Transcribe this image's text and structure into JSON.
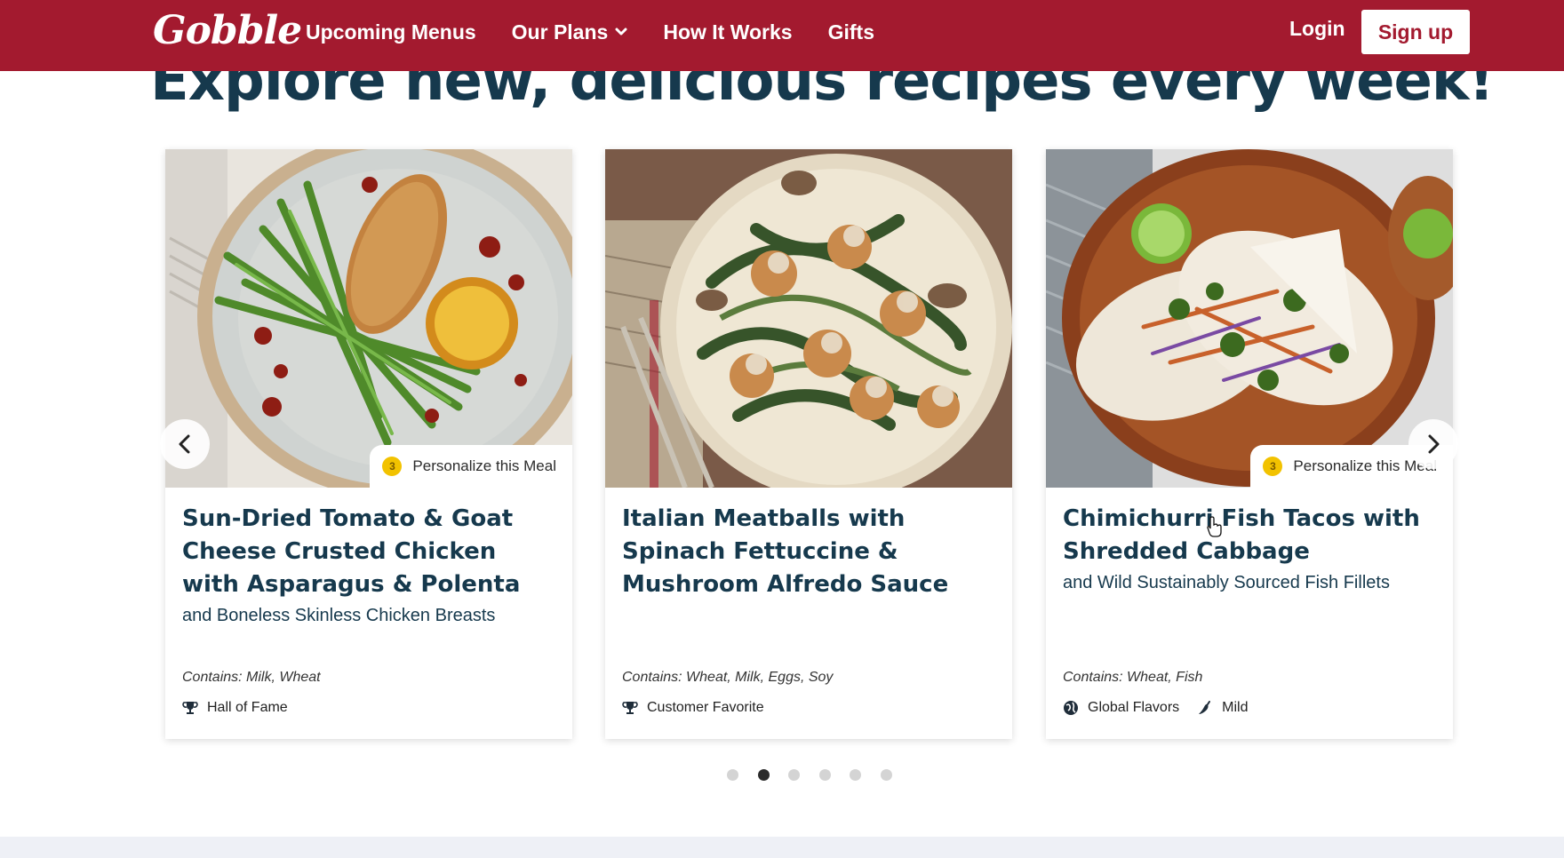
{
  "nav": {
    "logo": "Gobble",
    "links": [
      "Upcoming Menus",
      "Our Plans",
      "How It Works",
      "Gifts"
    ],
    "login": "Login",
    "signup": "Sign up"
  },
  "hero": {
    "title": "Explore new, delicious recipes every week!"
  },
  "colors": {
    "brand": "#a31a2f",
    "heading": "#16394d",
    "badge": "#f2c200"
  },
  "cards": [
    {
      "title": "Sun-Dried Tomato & Goat Cheese Crusted Chicken with Asparagus & Polenta",
      "subtitle": "and Boneless Skinless Chicken Breasts",
      "personalize_points": "3",
      "personalize": "Personalize this Meal",
      "contains": "Contains: Milk, Wheat",
      "tags": [
        {
          "icon": "trophy-icon",
          "label": "Hall of Fame"
        }
      ]
    },
    {
      "title": "Italian Meatballs with Spinach Fettuccine & Mushroom Alfredo Sauce",
      "subtitle": "",
      "contains": "Contains: Wheat, Milk, Eggs, Soy",
      "tags": [
        {
          "icon": "trophy-icon",
          "label": "Customer Favorite"
        }
      ]
    },
    {
      "title": "Chimichurri Fish Tacos with Shredded Cabbage",
      "subtitle": "and Wild Sustainably Sourced Fish Fillets",
      "personalize_points": "3",
      "personalize": "Personalize this Meal",
      "contains": "Contains: Wheat, Fish",
      "tags": [
        {
          "icon": "globe-icon",
          "label": "Global Flavors"
        },
        {
          "icon": "chili-pepper-icon",
          "label": "Mild"
        }
      ]
    }
  ],
  "carousel": {
    "total_pages": 6,
    "active_page": 2
  }
}
